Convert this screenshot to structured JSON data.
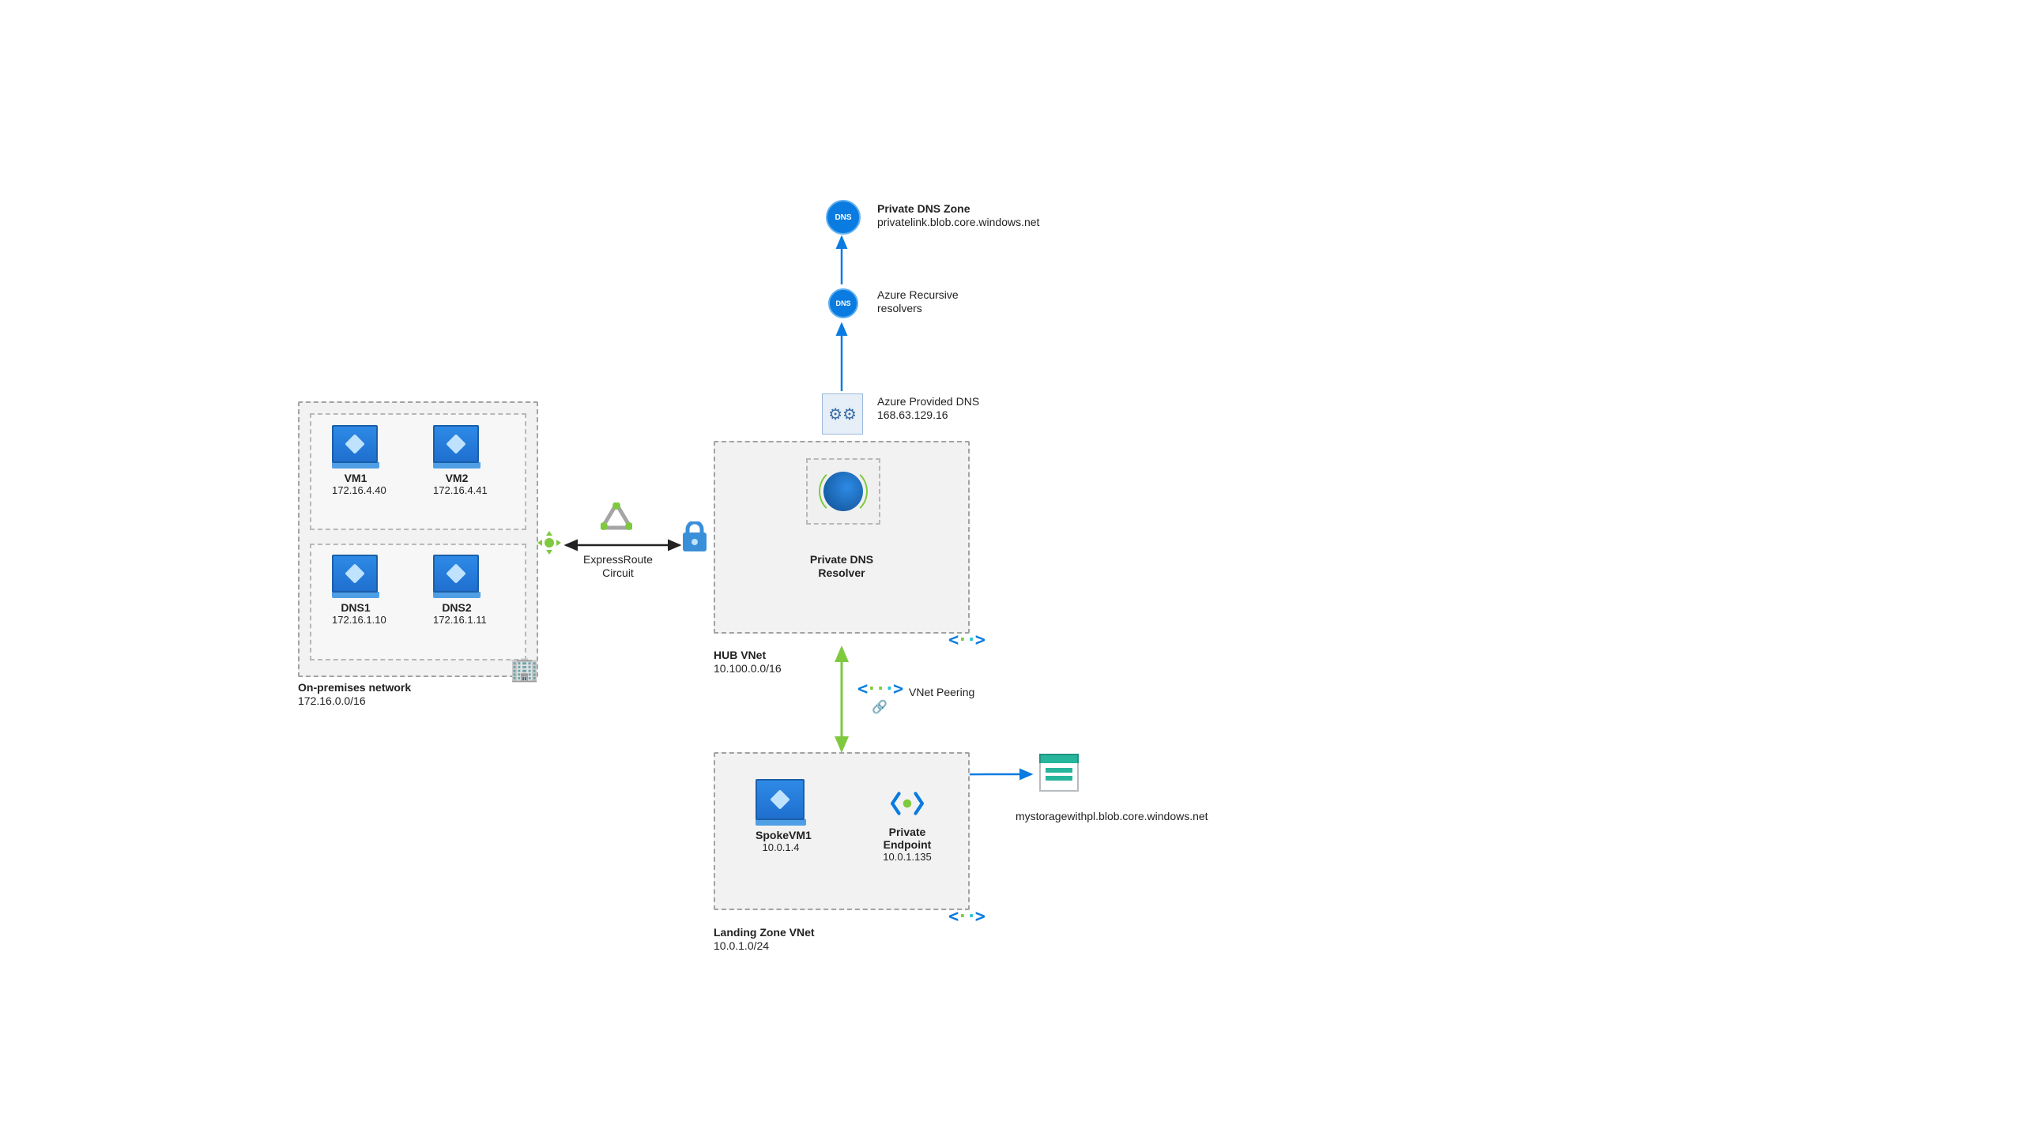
{
  "onprem": {
    "title": "On-premises network",
    "cidr": "172.16.0.0/16",
    "vm1": {
      "name": "VM1",
      "ip": "172.16.4.40"
    },
    "vm2": {
      "name": "VM2",
      "ip": "172.16.4.41"
    },
    "dns1": {
      "name": "DNS1",
      "ip": "172.16.1.10"
    },
    "dns2": {
      "name": "DNS2",
      "ip": "172.16.1.11"
    }
  },
  "expressroute": {
    "label": "ExpressRoute\nCircuit"
  },
  "hub": {
    "title": "HUB VNet",
    "cidr": "10.100.0.0/16",
    "resolver": "Private DNS\nResolver",
    "providedDns": {
      "label": "Azure Provided DNS",
      "ip": "168.63.129.16"
    },
    "recursive": "Azure Recursive\nresolvers",
    "privateZone": {
      "title": "Private DNS Zone",
      "zone": "privatelink.blob.core.windows.net"
    }
  },
  "peering": "VNet Peering",
  "lz": {
    "title": "Landing Zone VNet",
    "cidr": "10.0.1.0/24",
    "spoke": {
      "name": "SpokeVM1",
      "ip": "10.0.1.4"
    },
    "pe": {
      "name": "Private\nEndpoint",
      "ip": "10.0.1.135"
    }
  },
  "storage": "mystoragewithpl.blob.core.windows.net",
  "dnsBadge": "DNS"
}
